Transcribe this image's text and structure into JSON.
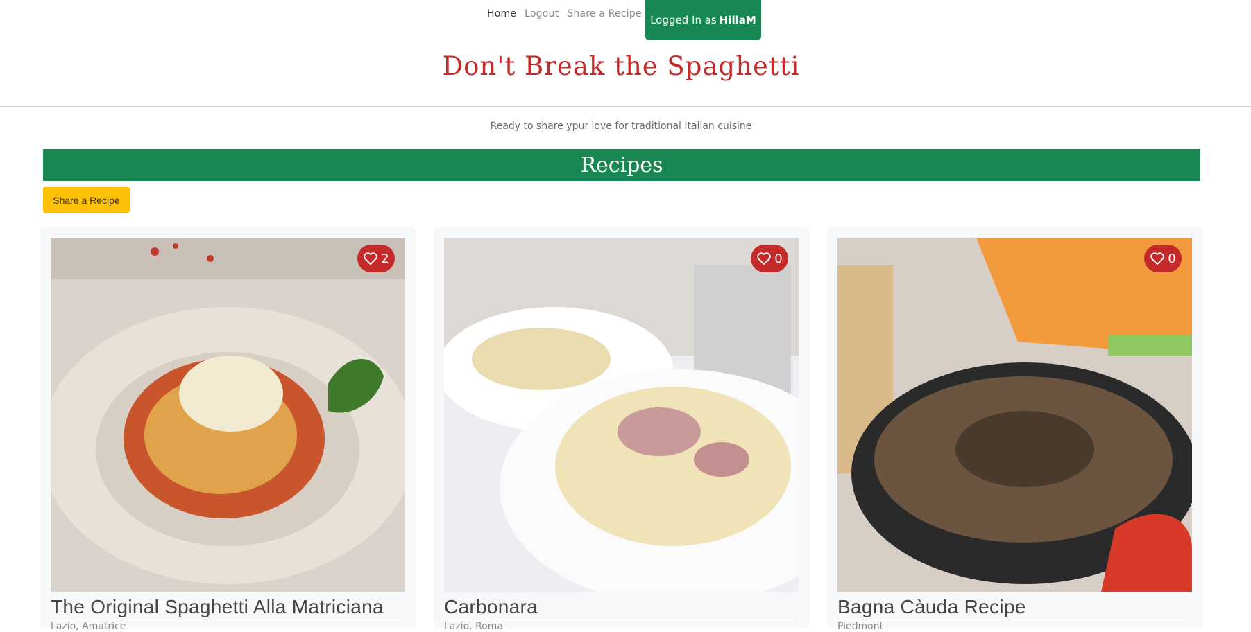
{
  "nav": {
    "links": [
      "Home",
      "Logout",
      "Share a Recipe"
    ],
    "logged_in_prefix": "Logged In as",
    "username": "HillaM"
  },
  "brand": {
    "title": "Don't Break the Spaghetti"
  },
  "tagline": "Ready to share ypur love for traditional Italian cuisine",
  "section": {
    "title": "Recipes"
  },
  "actions": {
    "share_label": "Share a Recipe"
  },
  "colors": {
    "green": "#188751",
    "red": "#c52a2a",
    "yellow": "#ffc107"
  },
  "recipes": [
    {
      "title": "The Original Spaghetti Alla Matriciana",
      "region": "Lazio, Amatrice",
      "likes": "2",
      "icon": "heart-icon"
    },
    {
      "title": "Carbonara",
      "region": "Lazio, Roma",
      "likes": "0",
      "icon": "heart-icon"
    },
    {
      "title": "Bagna Càuda Recipe",
      "region": "Piedmont",
      "likes": "0",
      "icon": "heart-icon"
    }
  ]
}
